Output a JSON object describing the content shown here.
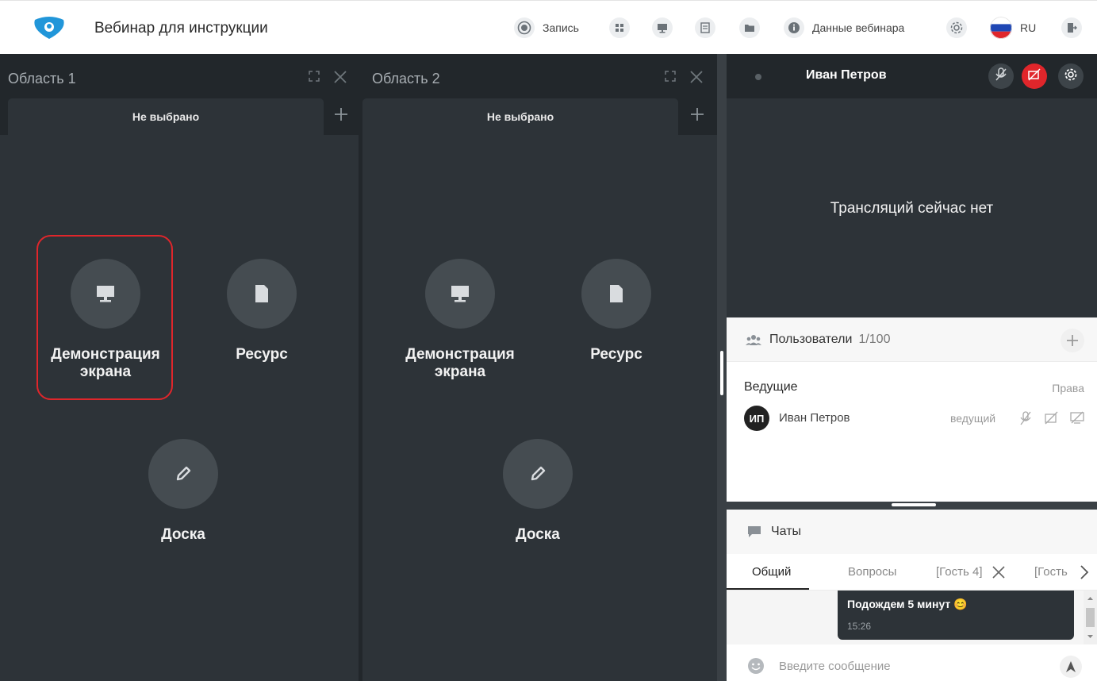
{
  "header": {
    "title": "Вебинар для инструкции",
    "record_label": "Запись",
    "webinar_data_label": "Данные вебинара",
    "language": "RU"
  },
  "areas": [
    {
      "title": "Область 1",
      "tab": "Не выбрано",
      "tiles": {
        "screen": "Демонстрация экрана",
        "resource": "Ресурс",
        "board": "Доска"
      }
    },
    {
      "title": "Область 2",
      "tab": "Не выбрано",
      "tiles": {
        "screen": "Демонстрация экрана",
        "resource": "Ресурс",
        "board": "Доска"
      }
    }
  ],
  "video": {
    "presenter_name": "Иван Петров",
    "no_streams": "Трансляций сейчас нет"
  },
  "users": {
    "title": "Пользователи",
    "count": "1/100",
    "hosts_label": "Ведущие",
    "rights_label": "Права",
    "list": [
      {
        "initials": "ИП",
        "name": "Иван Петров",
        "role": "ведущий"
      }
    ]
  },
  "chats": {
    "title": "Чаты",
    "tabs": [
      "Общий",
      "Вопросы",
      "[Гость 4]",
      "[Гость"
    ],
    "message": {
      "text": "Подождем 5 минут",
      "emoji": "😊",
      "time": "15:26"
    },
    "input_placeholder": "Введите сообщение"
  },
  "colors": {
    "accent_red": "#e0262b",
    "area_bg": "#2d3338",
    "logo_blue": "#2196d9"
  }
}
